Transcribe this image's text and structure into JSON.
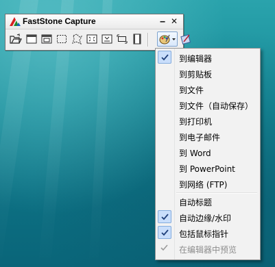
{
  "window": {
    "title": "FastStone Capture",
    "minimize_label": "‒",
    "close_label": "✕"
  },
  "toolbar": {
    "buttons": [
      {
        "name": "open-file-icon"
      },
      {
        "name": "capture-active-window-icon"
      },
      {
        "name": "capture-window-object-icon"
      },
      {
        "name": "capture-rectangular-region-icon"
      },
      {
        "name": "capture-freehand-region-icon"
      },
      {
        "name": "capture-full-screen-icon"
      },
      {
        "name": "capture-scrolling-window-icon"
      },
      {
        "name": "capture-fixed-region-icon"
      },
      {
        "name": "screen-recorder-icon"
      },
      {
        "name": "output-destination-icon"
      },
      {
        "name": "settings-icon"
      }
    ]
  },
  "menu": {
    "items": [
      {
        "label": "到编辑器",
        "checked": true
      },
      {
        "label": "到剪贴板",
        "checked": false
      },
      {
        "label": "到文件",
        "checked": false
      },
      {
        "label": "到文件（自动保存）",
        "checked": false
      },
      {
        "label": "到打印机",
        "checked": false
      },
      {
        "label": "到电子邮件",
        "checked": false
      },
      {
        "label": "到 Word",
        "checked": false
      },
      {
        "label": "到 PowerPoint",
        "checked": false
      },
      {
        "label": "到网络 (FTP)",
        "checked": false
      },
      {
        "label": "自动标题",
        "checked": false
      },
      {
        "label": "自动边缘/水印",
        "checked": true
      },
      {
        "label": "包括鼠标指针",
        "checked": true
      },
      {
        "label": "在编辑器中预览",
        "checked": true,
        "disabled": true
      }
    ]
  },
  "colors": {
    "desktop": "#168a98",
    "menu_bg": "#f2f2f2",
    "check_bg": "#c9defb",
    "check_border": "#84acdd",
    "check_mark": "#1f3f7a",
    "disabled_text": "#8d8d8d"
  }
}
